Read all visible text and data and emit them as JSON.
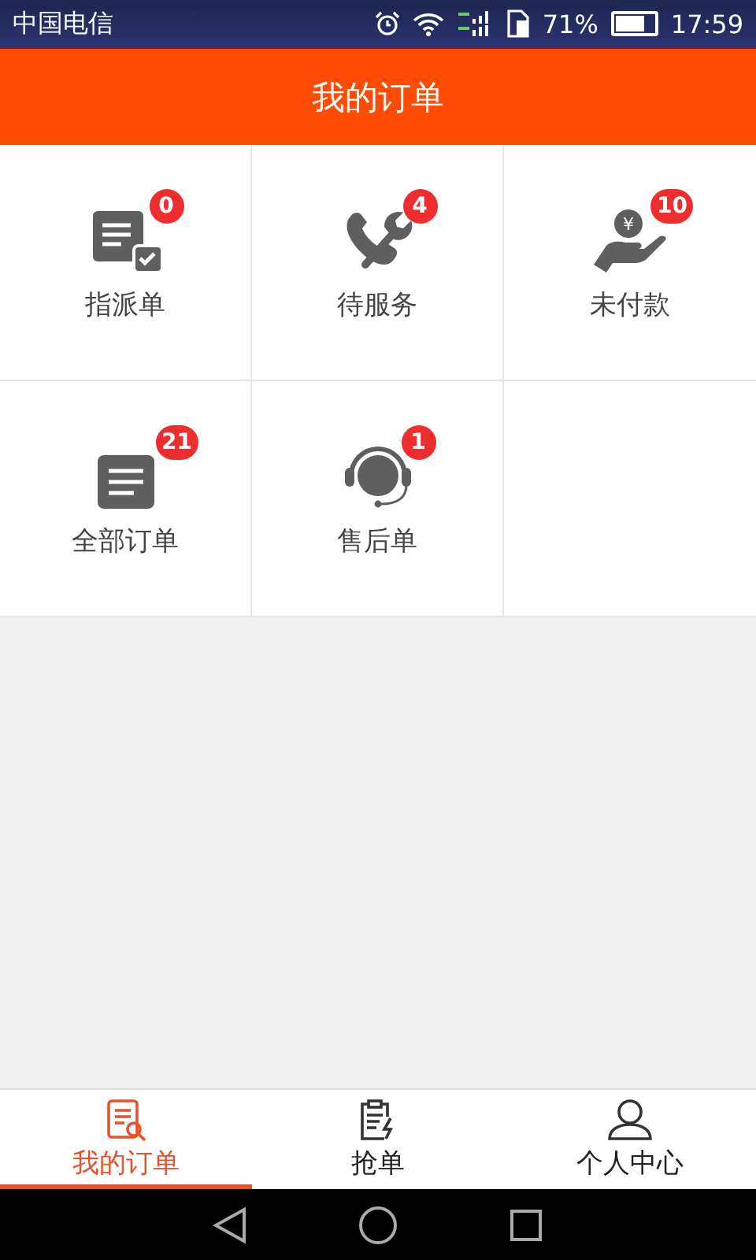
{
  "status_bar": {
    "carrier": "中国电信",
    "battery": "71%",
    "time": "17:59"
  },
  "header": {
    "title": "我的订单"
  },
  "orders": [
    {
      "kind": "assigned",
      "label": "指派单",
      "count": "0"
    },
    {
      "kind": "service",
      "label": "待服务",
      "count": "4"
    },
    {
      "kind": "unpaid",
      "label": "未付款",
      "count": "10",
      "coin_symbol": "¥"
    },
    {
      "kind": "all",
      "label": "全部订单",
      "count": "21"
    },
    {
      "kind": "aftersale",
      "label": "售后单",
      "count": "1"
    }
  ],
  "tabs": [
    {
      "kind": "orders",
      "label": "我的订单",
      "selected": true
    },
    {
      "kind": "grab",
      "label": "抢单",
      "selected": false
    },
    {
      "kind": "profile",
      "label": "个人中心",
      "selected": false
    }
  ]
}
